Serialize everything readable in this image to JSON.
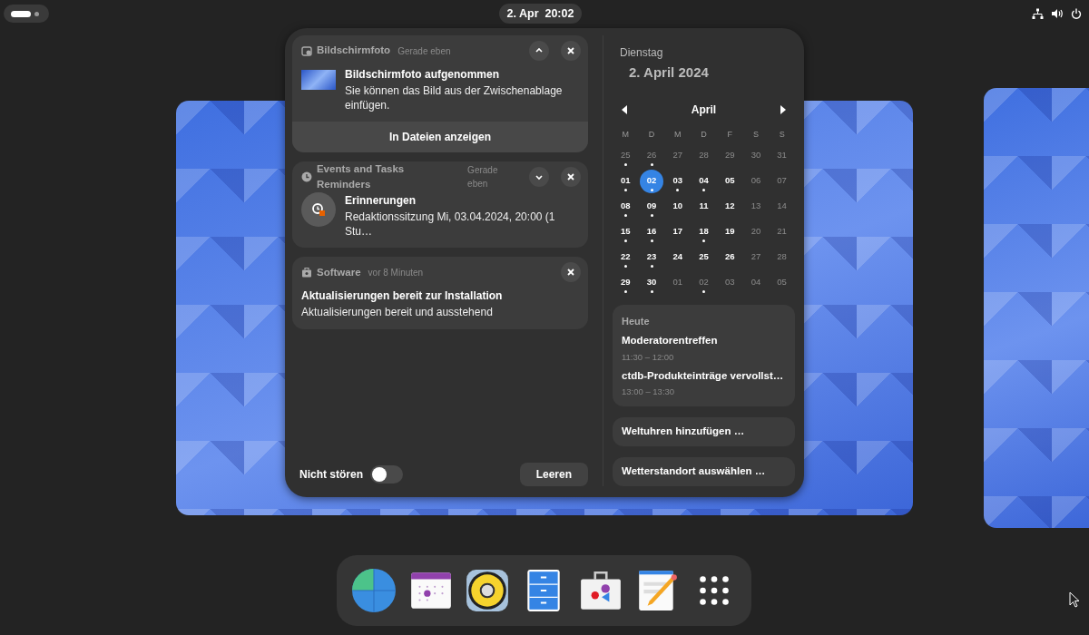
{
  "top_bar": {
    "clock": "2. Apr  20:02",
    "workspace_indicator": [
      {
        "selected": true
      },
      {
        "selected": false
      }
    ]
  },
  "notifications": [
    {
      "kind": "screenshot",
      "app": "Bildschirmfoto",
      "time": "Gerade eben",
      "expanded": true,
      "title": "Bildschirmfoto aufgenommen",
      "body": "Sie können das Bild aus der Zwischenablage einfügen.",
      "action": "In Dateien anzeigen"
    },
    {
      "kind": "reminder",
      "app": "Events and Tasks Reminders",
      "time": "Gerade eben",
      "expanded": false,
      "title": "Erinnerungen",
      "body": "Redaktionssitzung Mi, 03.04.2024, 20:00 (1 Stu…"
    },
    {
      "kind": "update",
      "app": "Software",
      "time": "vor 8 Minuten",
      "title": "Aktualisierungen bereit zur Installation",
      "body": "Aktualisierungen bereit und ausstehend"
    }
  ],
  "dnd": {
    "label": "Nicht stören",
    "on": false
  },
  "clear_button": "Leeren",
  "date": {
    "weekday": "Dienstag",
    "full": "2. April 2024"
  },
  "calendar": {
    "month": "April",
    "weekdays": [
      "M",
      "D",
      "M",
      "D",
      "F",
      "S",
      "S"
    ],
    "days": [
      {
        "day": "25",
        "dim": true,
        "dot": true,
        "selected": false
      },
      {
        "day": "26",
        "dim": true,
        "dot": true,
        "selected": false
      },
      {
        "day": "27",
        "dim": true,
        "dot": false,
        "selected": false
      },
      {
        "day": "28",
        "dim": true,
        "dot": false,
        "selected": false
      },
      {
        "day": "29",
        "dim": true,
        "dot": false,
        "selected": false
      },
      {
        "day": "30",
        "dim": true,
        "dot": false,
        "selected": false
      },
      {
        "day": "31",
        "dim": true,
        "dot": false,
        "selected": false
      },
      {
        "day": "01",
        "dim": false,
        "dot": true,
        "selected": false
      },
      {
        "day": "02",
        "dim": false,
        "dot": true,
        "selected": true
      },
      {
        "day": "03",
        "dim": false,
        "dot": true,
        "selected": false
      },
      {
        "day": "04",
        "dim": false,
        "dot": true,
        "selected": false
      },
      {
        "day": "05",
        "dim": false,
        "dot": false,
        "selected": false
      },
      {
        "day": "06",
        "dim": true,
        "dot": false,
        "selected": false
      },
      {
        "day": "07",
        "dim": true,
        "dot": false,
        "selected": false
      },
      {
        "day": "08",
        "dim": false,
        "dot": true,
        "selected": false
      },
      {
        "day": "09",
        "dim": false,
        "dot": true,
        "selected": false
      },
      {
        "day": "10",
        "dim": false,
        "dot": false,
        "selected": false
      },
      {
        "day": "11",
        "dim": false,
        "dot": false,
        "selected": false
      },
      {
        "day": "12",
        "dim": false,
        "dot": false,
        "selected": false
      },
      {
        "day": "13",
        "dim": true,
        "dot": false,
        "selected": false
      },
      {
        "day": "14",
        "dim": true,
        "dot": false,
        "selected": false
      },
      {
        "day": "15",
        "dim": false,
        "dot": true,
        "selected": false
      },
      {
        "day": "16",
        "dim": false,
        "dot": true,
        "selected": false
      },
      {
        "day": "17",
        "dim": false,
        "dot": false,
        "selected": false
      },
      {
        "day": "18",
        "dim": false,
        "dot": true,
        "selected": false
      },
      {
        "day": "19",
        "dim": false,
        "dot": false,
        "selected": false
      },
      {
        "day": "20",
        "dim": true,
        "dot": false,
        "selected": false
      },
      {
        "day": "21",
        "dim": true,
        "dot": false,
        "selected": false
      },
      {
        "day": "22",
        "dim": false,
        "dot": true,
        "selected": false
      },
      {
        "day": "23",
        "dim": false,
        "dot": true,
        "selected": false
      },
      {
        "day": "24",
        "dim": false,
        "dot": false,
        "selected": false
      },
      {
        "day": "25",
        "dim": false,
        "dot": false,
        "selected": false
      },
      {
        "day": "26",
        "dim": false,
        "dot": false,
        "selected": false
      },
      {
        "day": "27",
        "dim": true,
        "dot": false,
        "selected": false
      },
      {
        "day": "28",
        "dim": true,
        "dot": false,
        "selected": false
      },
      {
        "day": "29",
        "dim": false,
        "dot": true,
        "selected": false
      },
      {
        "day": "30",
        "dim": false,
        "dot": true,
        "selected": false
      },
      {
        "day": "01",
        "dim": true,
        "dot": false,
        "selected": false
      },
      {
        "day": "02",
        "dim": true,
        "dot": true,
        "selected": false
      },
      {
        "day": "03",
        "dim": true,
        "dot": false,
        "selected": false
      },
      {
        "day": "04",
        "dim": true,
        "dot": false,
        "selected": false
      },
      {
        "day": "05",
        "dim": true,
        "dot": false,
        "selected": false
      }
    ]
  },
  "events": {
    "heading": "Heute",
    "items": [
      {
        "title": "Moderatorentreffen",
        "time": "11:30 – 12:00"
      },
      {
        "title": "ctdb-Produkteinträge vervollst…",
        "time": "13:00 – 13:30"
      }
    ]
  },
  "world_clocks_button": "Weltuhren hinzufügen …",
  "weather_button": "Wetterstandort auswählen …",
  "dock": [
    {
      "kind": "browser"
    },
    {
      "kind": "calendar"
    },
    {
      "kind": "music"
    },
    {
      "kind": "files"
    },
    {
      "kind": "store"
    },
    {
      "kind": "editor"
    },
    {
      "kind": "launcher"
    }
  ]
}
